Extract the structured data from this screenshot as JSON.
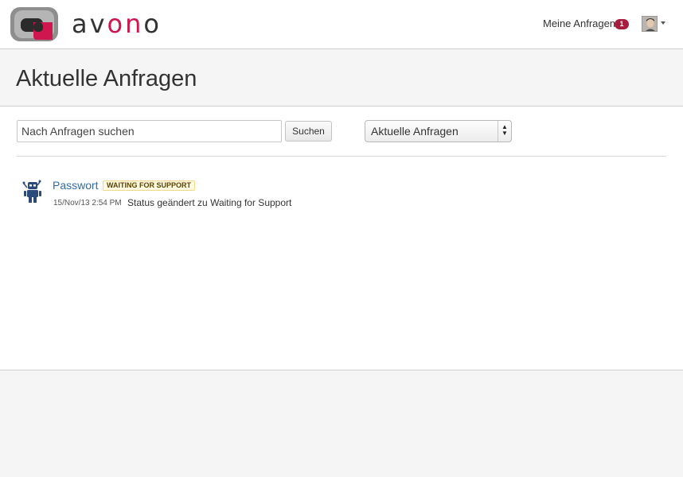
{
  "header": {
    "brand_prefix": "av",
    "brand_highlight": "on",
    "brand_suffix": "o",
    "my_requests_label": "Meine Anfragen",
    "my_requests_count": "1",
    "brand_color": "#d0164f"
  },
  "page": {
    "title": "Aktuelle Anfragen"
  },
  "search": {
    "placeholder": "Nach Anfragen suchen",
    "value": "",
    "button_label": "Suchen"
  },
  "filter": {
    "selected": "Aktuelle Anfragen"
  },
  "requests": [
    {
      "title": "Passwort",
      "status": "WAITING FOR SUPPORT",
      "timestamp": "15/Nov/13 2:54 PM",
      "activity": "Status geändert zu Waiting for Support",
      "icon": "robot-icon"
    }
  ]
}
